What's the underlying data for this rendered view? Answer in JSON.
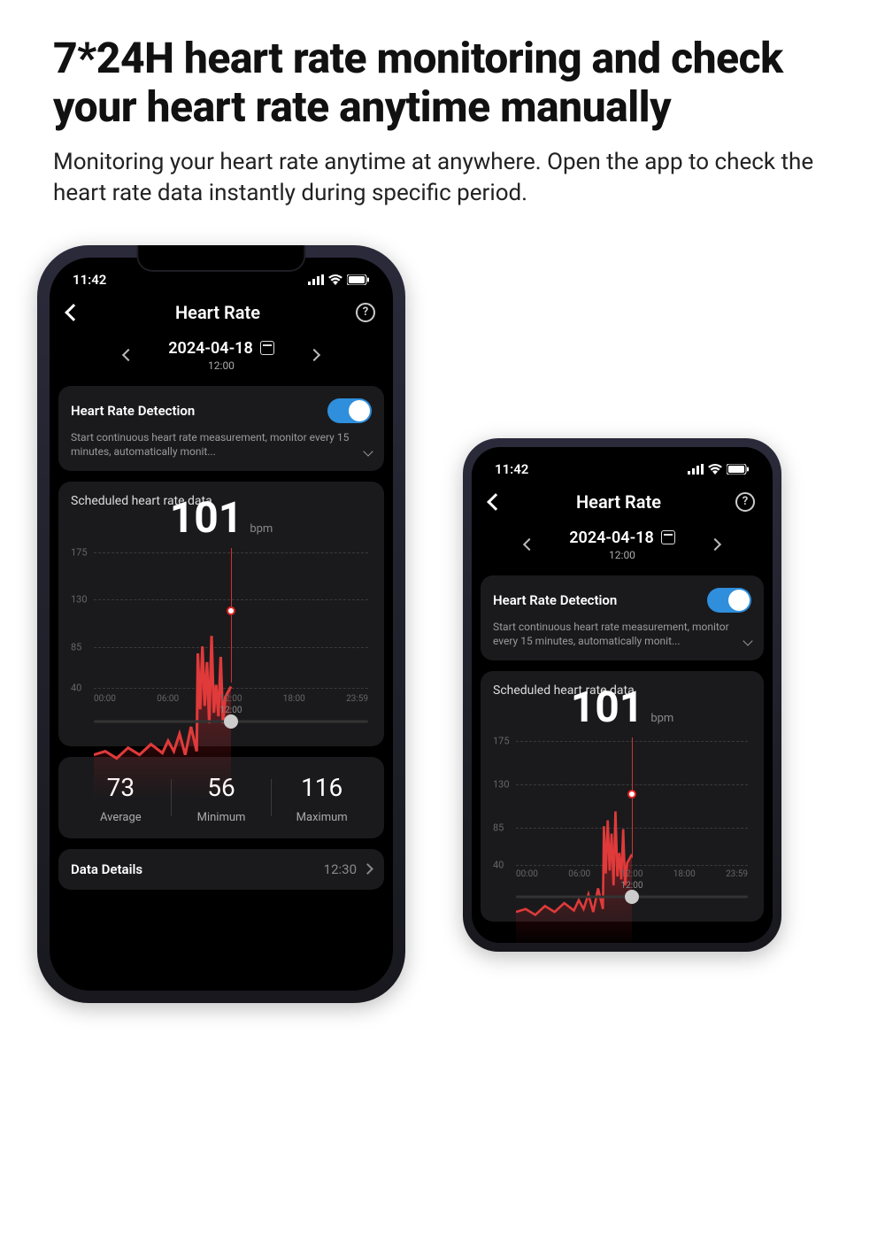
{
  "marketing": {
    "headline": "7*24H heart rate monitoring and check your heart rate anytime manually",
    "subhead": "Monitoring your heart rate anytime at anywhere. Open the app to check the heart rate data instantly during specific period."
  },
  "status": {
    "time": "11:42"
  },
  "header": {
    "title": "Heart Rate"
  },
  "date_selector": {
    "date": "2024-04-18",
    "time": "12:00"
  },
  "detection": {
    "title": "Heart Rate Detection",
    "desc": "Start continuous heart rate measurement, monitor every 15 minutes, automatically monit...",
    "enabled": true
  },
  "scheduled": {
    "title": "Scheduled heart rate data",
    "value": "101",
    "unit": "bpm"
  },
  "chart_data": {
    "type": "line",
    "title": "Scheduled heart rate data",
    "ylabel": "bpm",
    "ylim": [
      40,
      175
    ],
    "y_ticks": [
      40,
      85,
      130,
      175
    ],
    "x_ticks": [
      "00:00",
      "06:00",
      "12:00",
      "18:00",
      "23:59"
    ],
    "cursor": {
      "x": "12:00",
      "y": 101
    },
    "x": [
      "00:00",
      "01:00",
      "02:00",
      "03:00",
      "04:00",
      "05:00",
      "06:00",
      "06:30",
      "07:00",
      "07:30",
      "08:00",
      "08:30",
      "09:00",
      "09:06",
      "09:18",
      "09:30",
      "09:42",
      "09:54",
      "10:06",
      "10:18",
      "10:30",
      "10:42",
      "10:54",
      "11:06",
      "11:18",
      "11:30",
      "12:00"
    ],
    "values": [
      62,
      64,
      60,
      66,
      62,
      68,
      63,
      70,
      64,
      74,
      62,
      78,
      64,
      120,
      88,
      124,
      90,
      115,
      80,
      130,
      86,
      102,
      84,
      118,
      80,
      95,
      101
    ]
  },
  "scrubber": {
    "label": "12:00",
    "position_pct": 50
  },
  "stats": {
    "average": {
      "value": "73",
      "label": "Average"
    },
    "minimum": {
      "value": "56",
      "label": "Minimum"
    },
    "maximum": {
      "value": "116",
      "label": "Maximum"
    }
  },
  "details": {
    "title": "Data Details",
    "time": "12:30"
  }
}
